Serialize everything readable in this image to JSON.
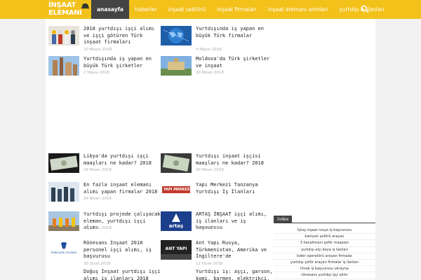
{
  "logo": {
    "line1": "İNŞAAT",
    "line2": "ELEMANI"
  },
  "nav": [
    "anasayfa",
    "haberler",
    "inşaat sektörü",
    "inşaat firmaları",
    "inşaat elemanı alımları",
    "yurtdışı iş ilanları"
  ],
  "posts": [
    {
      "title": "2018 yurtdışı işçi alımı ve işçi götüren Türk inşaat firmaları",
      "date": "10 Mayıs 2018"
    },
    {
      "title": "Yurtdışında iş yapan en büyük Türk firmalar",
      "date": "4 Mayıs 2018"
    },
    {
      "title": "Yurtdışında iş yapan en büyük Türk şirketler",
      "date": "2 Mayıs 2018"
    },
    {
      "title": "Moldova'da Türk şirketler ve inşaat",
      "date": "30 Nisan 2018"
    },
    {
      "title": "Libya'da yurtdışı işçi maaşları ne kadar? 2018",
      "date": "29 Nisan 2018"
    },
    {
      "title": "Yurtdışı inşaat işçisi maaşları ne kadar? 2018",
      "date": "29 Nisan 2018"
    },
    {
      "title": "En fazla inşaat elemanı alımı yapan firmalar 2018",
      "date": "26 Nisan 2018"
    },
    {
      "title": "Yapı Merkezi Tanzanya Yurtdışı İş İlanları",
      "date": ""
    },
    {
      "title": "Yurtdışı projede çalışacak eleman, yurtdışı işçi alımı",
      "date": "21 Nisan 2018"
    },
    {
      "title": "ARTAŞ İNŞAAT işçi alımı, iş ilanları ve iş başvurusu",
      "date": "2 Mart 2018"
    },
    {
      "title": "Rönesans İnşaat 2018 personel işçi alımı, iş başvurusu",
      "date": "30 Ocak 2018"
    },
    {
      "title": "Ant Yapı Rusya, Türkmenistan, Amerika ve İngiltere'de",
      "date": "12 Ocak 2018"
    },
    {
      "title": "Doğuş İnşaat yurtdışı işçi alımı iş ilanları 2018",
      "date": ""
    },
    {
      "title": "Yurtdışı iş: aşçı, garson, komi, barmen, elektrikçi, tesisatçı",
      "date": ""
    }
  ],
  "thumb_labels": {
    "yapi_merkezi": "YAPI MERKEZİ",
    "artas": "artaş",
    "ant_yapi": "ANT YAPI",
    "ronesans": "RÖNESANS HOLDİNG"
  },
  "sidebar": {
    "title": "index",
    "tags": [
      "İçtaş inşaat rusya iş başvurusu",
      "kamyon şoförü arayan",
      "3 havalimanı şoför maaşları",
      "yurtdışı alçı boya iş ilanları",
      "loder operatörü arayan firmalar",
      "yurtdışı şoför arayan firmalar iş ilanları",
      "limak iş başvurusu ukrayna",
      "rönesans yurtdışı işçi alımı"
    ]
  },
  "colors": {
    "topbar": "#f2c11a",
    "active_nav": "#444444"
  }
}
